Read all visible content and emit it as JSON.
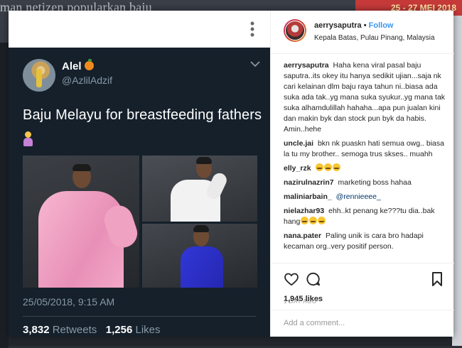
{
  "background": {
    "headline": "man netizen popularkan baju",
    "banner_text": "25 - 27 MEI 2018"
  },
  "tweet": {
    "name": "Alel",
    "handle": "@AzlilAdzif",
    "text": "Baju Melayu for breastfeeding fathers",
    "date": "25/05/2018, 9:15 AM",
    "retweets_count": "3,832",
    "retweets_label": "Retweets",
    "likes_count": "1,256",
    "likes_label": "Likes"
  },
  "post": {
    "username": "aerrysaputra",
    "separator": "•",
    "follow_label": "Follow",
    "location": "Kepala Batas, Pulau Pinang, Malaysia",
    "caption": {
      "user": "aerrysaputra",
      "text": "Haha kena viral pasal baju saputra..its okey itu hanya sedikit ujian...saja nk cari kelainan dlm baju raya tahun ni..biasa ada suka ada tak..yg mana suka syukur..yg mana tak suka alhamdulillah hahaha...apa pun jualan kini dan makin byk dan stock pun byk da habis.",
      "signoff": "Amin..hehe"
    },
    "comments": [
      {
        "user": "uncle.jai",
        "text": "bkn nk puaskn hati semua owg.. biasa la tu my brother.. semoga trus skses.. muahh"
      },
      {
        "user": "elly_rzk",
        "text": ""
      },
      {
        "user": "nazirulnazrin7",
        "text": "marketing boss hahaa"
      },
      {
        "user": "maliniarbain_",
        "text": "@rennieeee_"
      },
      {
        "user": "nielazhar93",
        "text": "ehh..kt penang ke???tu dia..bak hang"
      },
      {
        "user": "nana.pater",
        "text": "Paling unik is cara bro hadapi kecaman org..very positif person."
      }
    ],
    "likes": "1,945 likes",
    "time_ago": "1 DAY AGO",
    "add_comment_placeholder": "Add a comment..."
  },
  "colors": {
    "tweet_bg": "#15202b",
    "follow_blue": "#3897f0",
    "shirt_pink": "#f0a2c3",
    "shirt_blue": "#2a2ec4"
  },
  "icons": [
    "more-options-icon",
    "orange-emoji-icon",
    "chevron-down-icon",
    "breastfeeding-emoji-icon",
    "grin-emoji-icon",
    "heart-icon",
    "comment-icon",
    "bookmark-icon"
  ]
}
